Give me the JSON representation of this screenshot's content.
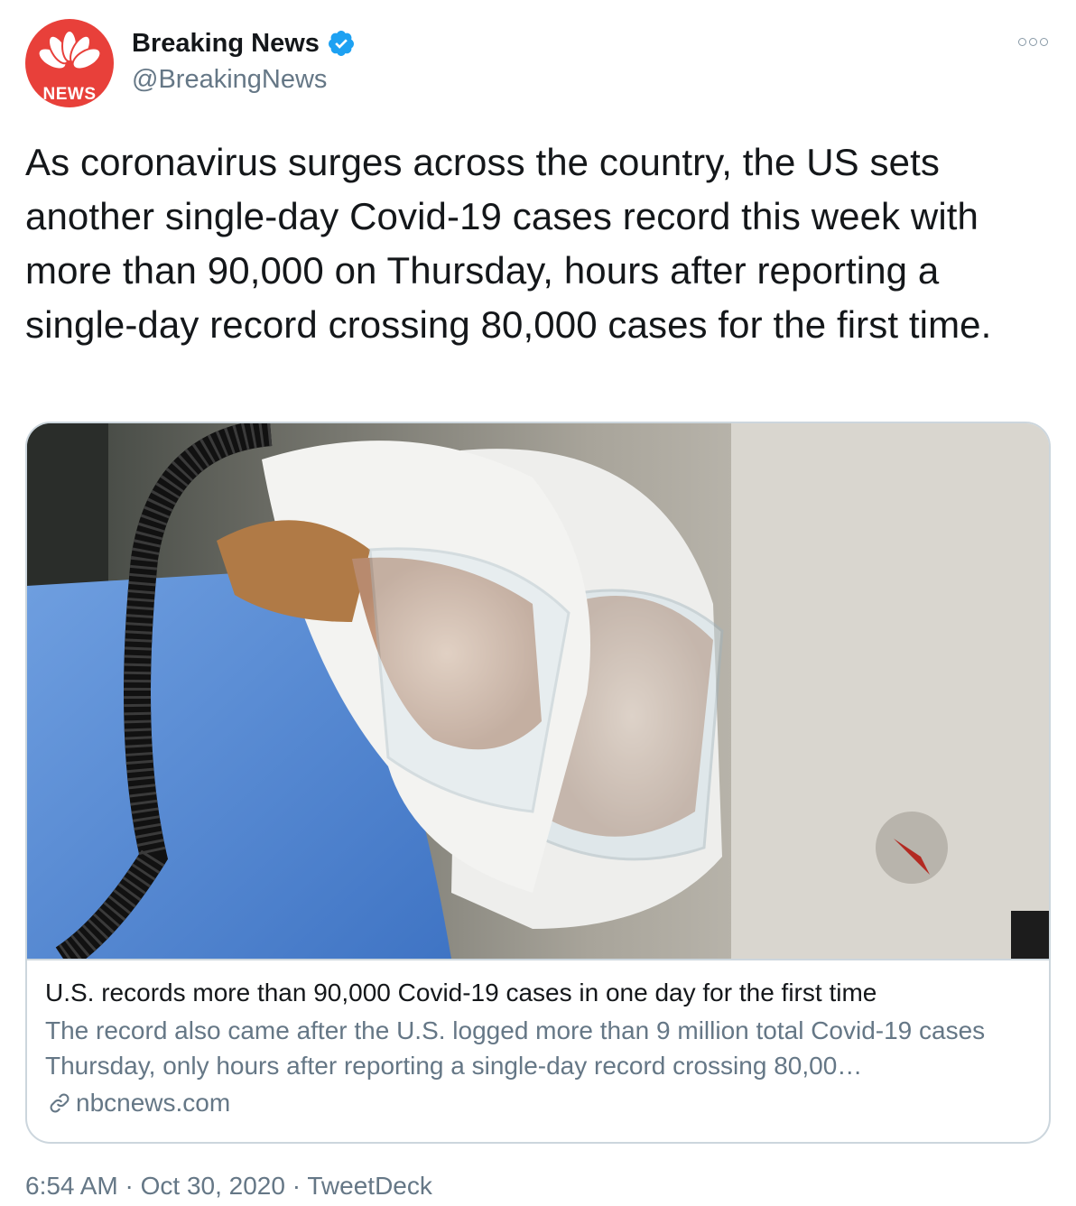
{
  "author": {
    "display_name": "Breaking News",
    "handle": "@BreakingNews",
    "avatar_text": "NEWS",
    "verified_icon": "verified-badge-icon",
    "brand_color": "#e8403a"
  },
  "tweet": {
    "text": "As coronavirus surges across the country, the US sets another single-day Covid-19 cases record this week with more than 90,000 on Thursday, hours after reporting a single-day record crossing 80,000 cases for the first time."
  },
  "card": {
    "image_icon": "photo-healthcare-workers-in-protective-hoods",
    "title": "U.S. records more than 90,000 Covid-19 cases in one day for the first time",
    "description": "The record also came after the U.S. logged more than 9 million total Covid-19 cases Thursday, only hours after reporting a single-day record crossing 80,00…",
    "domain": "nbcnews.com",
    "link_icon": "link-icon"
  },
  "footer": {
    "time": "6:54 AM",
    "separator": "·",
    "date": "Oct 30, 2020",
    "source": "TweetDeck"
  },
  "colors": {
    "text": "#14171a",
    "secondary": "#657786",
    "border": "#ccd6dd",
    "verified": "#1da1f2"
  }
}
